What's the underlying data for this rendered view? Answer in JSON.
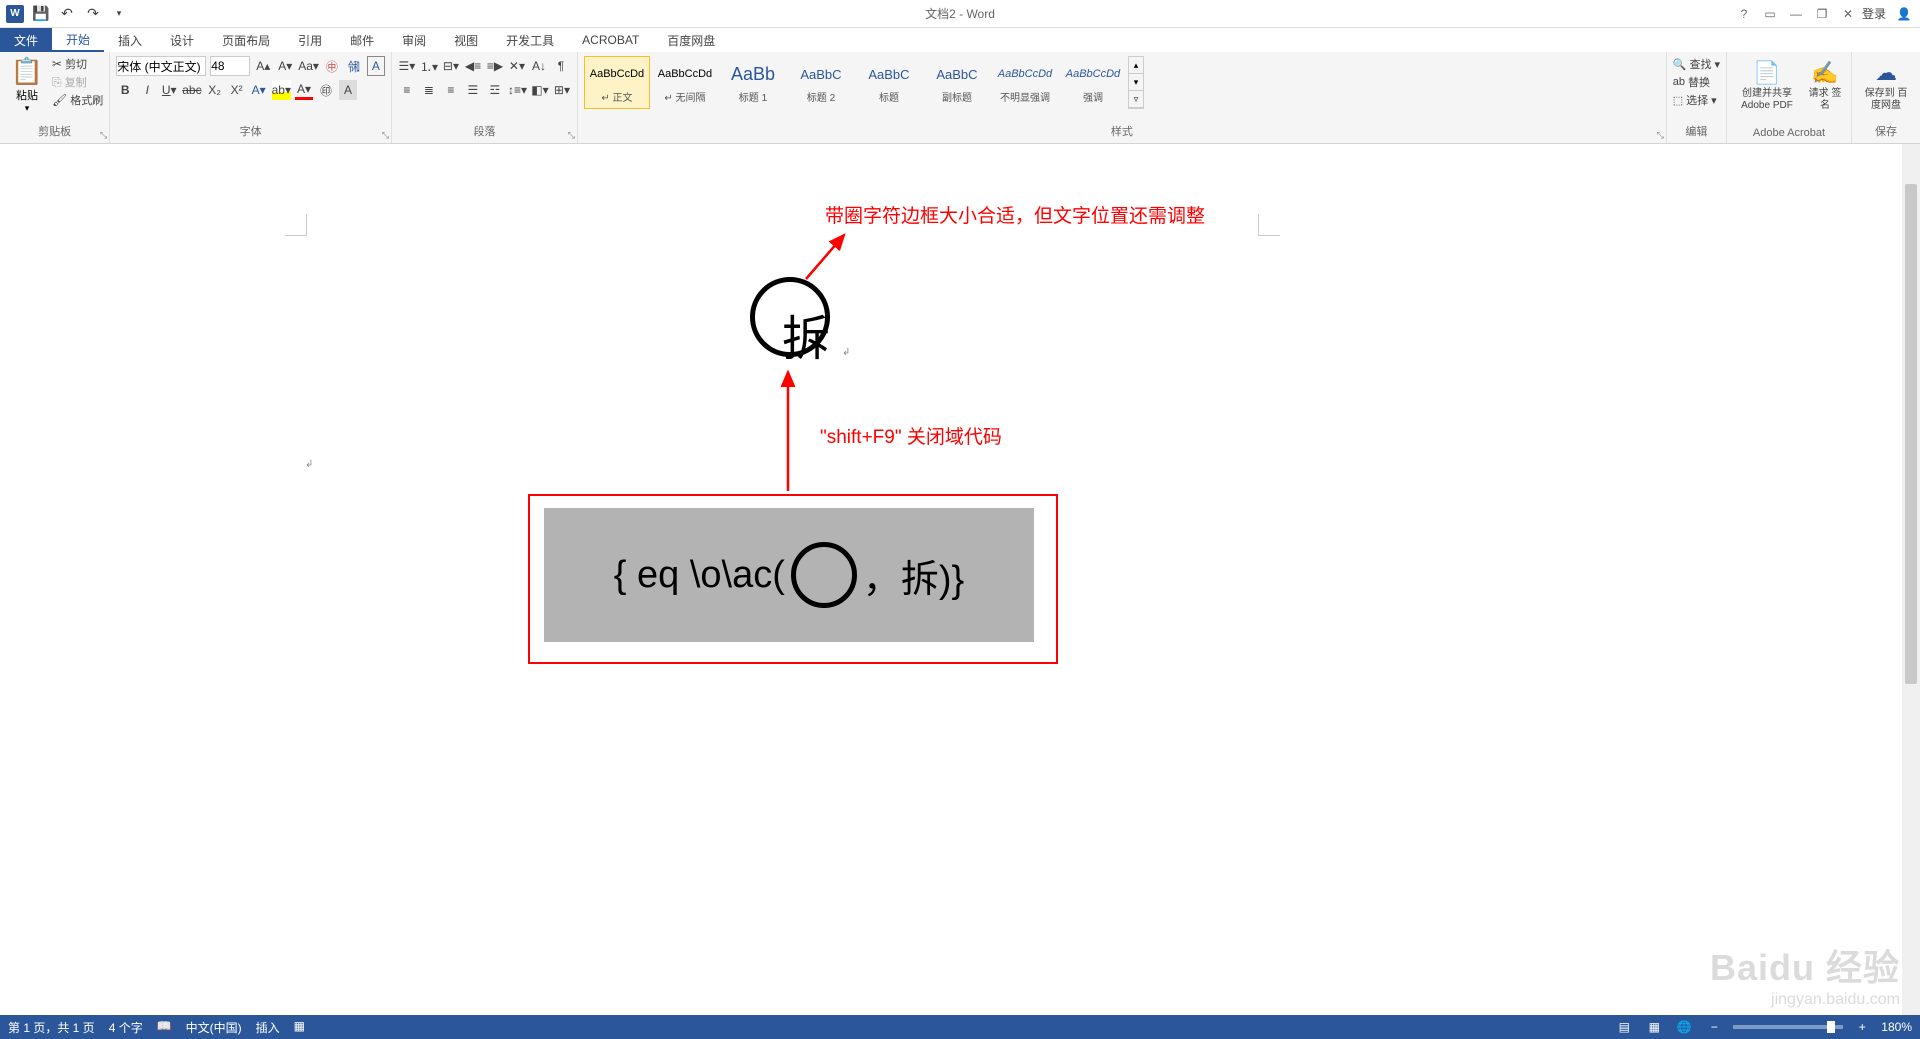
{
  "title": "文档2 - Word",
  "login": "登录",
  "tabs": {
    "file": "文件",
    "items": [
      "开始",
      "插入",
      "设计",
      "页面布局",
      "引用",
      "邮件",
      "审阅",
      "视图",
      "开发工具",
      "ACROBAT",
      "百度网盘"
    ],
    "active": 0
  },
  "clipboard": {
    "paste": "粘贴",
    "cut": "剪切",
    "copy": "复制",
    "painter": "格式刷",
    "label": "剪贴板"
  },
  "font": {
    "name": "宋体 (中文正文)",
    "size": "48",
    "label": "字体"
  },
  "paragraph": {
    "label": "段落"
  },
  "styles": {
    "label": "样式",
    "items": [
      {
        "preview": "AaBbCcDd",
        "name": "↵ 正文",
        "cls": ""
      },
      {
        "preview": "AaBbCcDd",
        "name": "↵ 无间隔",
        "cls": ""
      },
      {
        "preview": "AaBb",
        "name": "标题 1",
        "cls": "style-heading",
        "big": true
      },
      {
        "preview": "AaBbC",
        "name": "标题 2",
        "cls": "style-heading"
      },
      {
        "preview": "AaBbC",
        "name": "标题",
        "cls": "style-heading"
      },
      {
        "preview": "AaBbC",
        "name": "副标题",
        "cls": "style-heading"
      },
      {
        "preview": "AaBbCcDd",
        "name": "不明显强调",
        "cls": "style-italic"
      },
      {
        "preview": "AaBbCcDd",
        "name": "强调",
        "cls": "style-italic"
      }
    ]
  },
  "editing": {
    "find": "查找",
    "replace": "替换",
    "select": "选择",
    "label": "编辑"
  },
  "acrobat": {
    "create": "创建并共享\nAdobe PDF",
    "sign": "请求\n签名",
    "label": "Adobe Acrobat"
  },
  "baidu": {
    "save": "保存到\n百度网盘",
    "label": "保存"
  },
  "document": {
    "enclosed_char": "拆",
    "annotation1": "带圈字符边框大小合适，但文字位置还需调整",
    "annotation2": "\"shift+F9\" 关闭域代码",
    "field_prefix": "{ eq \\o\\ac(",
    "field_suffix": "，拆)}"
  },
  "statusbar": {
    "page": "第 1 页，共 1 页",
    "words": "4 个字",
    "lang": "中文(中国)",
    "mode": "插入",
    "zoom": "180%"
  },
  "watermark": {
    "logo": "Baidu 经验",
    "url": "jingyan.baidu.com"
  }
}
